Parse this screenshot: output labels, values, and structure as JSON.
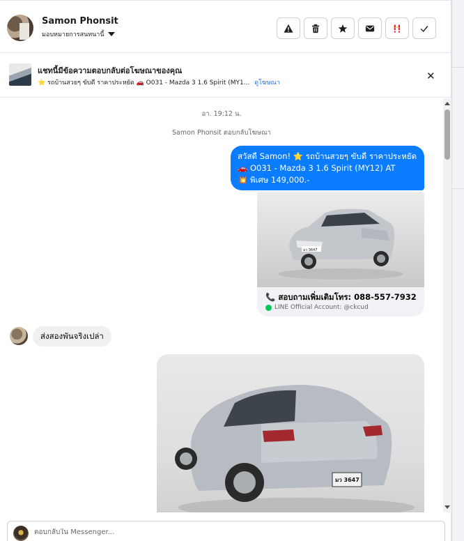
{
  "header": {
    "contact_name": "Samon Phonsit",
    "assign_label": "มอบหมายการสนทนานี้",
    "actions": [
      {
        "name": "report-spam-button",
        "icon": "warning-icon"
      },
      {
        "name": "delete-button",
        "icon": "trash-icon"
      },
      {
        "name": "star-button",
        "icon": "star-icon"
      },
      {
        "name": "mark-unread-button",
        "icon": "envelope-icon"
      },
      {
        "name": "follow-up-button",
        "icon": "follow-up-icon"
      },
      {
        "name": "mark-done-button",
        "icon": "check-icon"
      }
    ]
  },
  "ad_banner": {
    "title": "แชทนี้มีข้อความตอบกลับต่อโฆษณาของคุณ",
    "subtitle": "⭐ รถบ้านสวยๆ ขับดี ราคาประหยัด 🚗 O031 - Mazda 3 1.6 Spirit (MY1...",
    "link": "ดูโฆษณา"
  },
  "thread": {
    "timestamp": "อา. 19:12 น.",
    "replied_note": "Samon Phonsit ตอบกลับโฆษณา",
    "outgoing": {
      "line1": "สวัสดี Samon! ⭐ รถบ้านสวยๆ ขับดี ราคาประหยัด",
      "line2": "🚗 O031 - Mazda 3 1.6 Spirit (MY12) AT",
      "line3": "💥 พิเศษ 149,000.-"
    },
    "card": {
      "plate": "มว 3647",
      "line1": "📞 สอบถามเพิ่มเติมโทร: 088-557-7932",
      "line2": "LINE Official Account: @ckcud"
    },
    "incoming": {
      "text": "ส่งสองพันจริงเปล่า"
    },
    "photo_plate": "มว 3647"
  },
  "composer": {
    "placeholder": "ตอบกลับใน Messenger..."
  },
  "colors": {
    "brand_blue": "#0a7cff",
    "link_blue": "#1b74e4",
    "line_green": "#06c755"
  }
}
